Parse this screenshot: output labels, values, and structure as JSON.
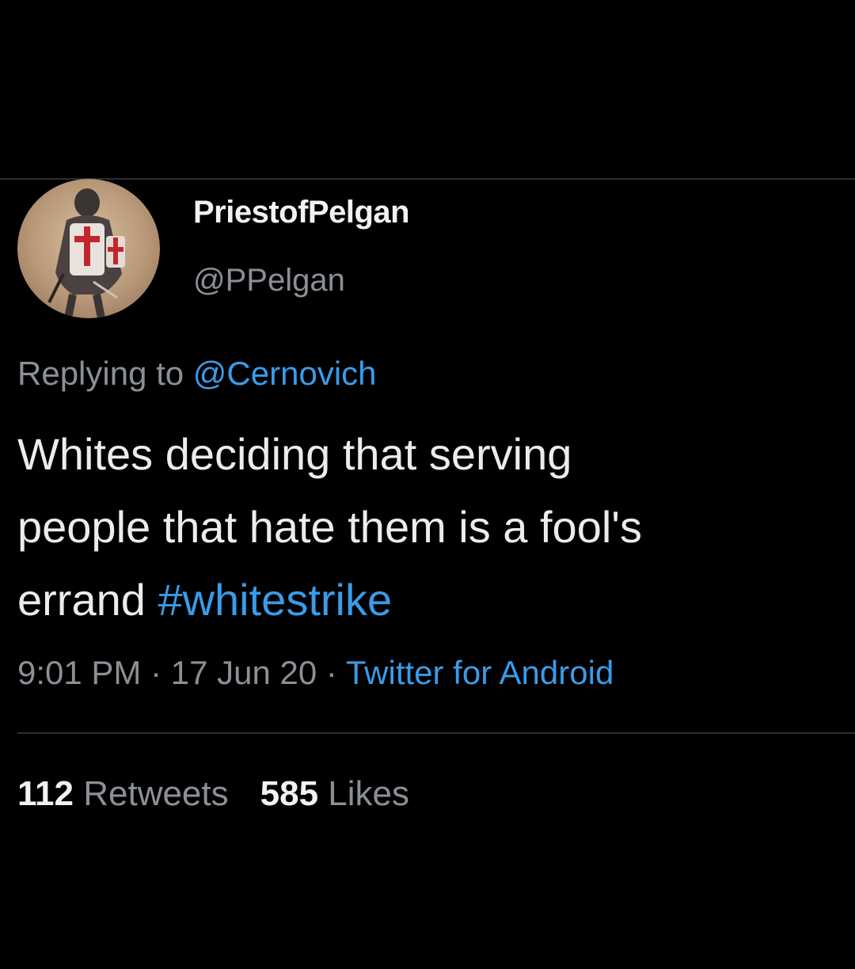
{
  "tweet": {
    "display_name": "PriestofPelgan",
    "handle": "@PPelgan",
    "avatar_icon": "templar-knight-avatar",
    "replying_to_prefix": "Replying to ",
    "replying_to_handle": "@Cernovich",
    "text_lines": [
      "Whites deciding that serving",
      "people that hate them is a fool's",
      "errand "
    ],
    "hashtag": "#whitestrike",
    "time": "9:01 PM",
    "separator": " · ",
    "date": "17 Jun 20",
    "source": "Twitter for Android"
  },
  "stats": {
    "retweets_count": "112",
    "retweets_label": "Retweets",
    "likes_count": "585",
    "likes_label": "Likes"
  },
  "colors": {
    "background": "#000000",
    "link": "#3a9be8",
    "secondary_text": "#8b9096",
    "primary_text": "#ececec",
    "divider": "#2a2d30"
  }
}
